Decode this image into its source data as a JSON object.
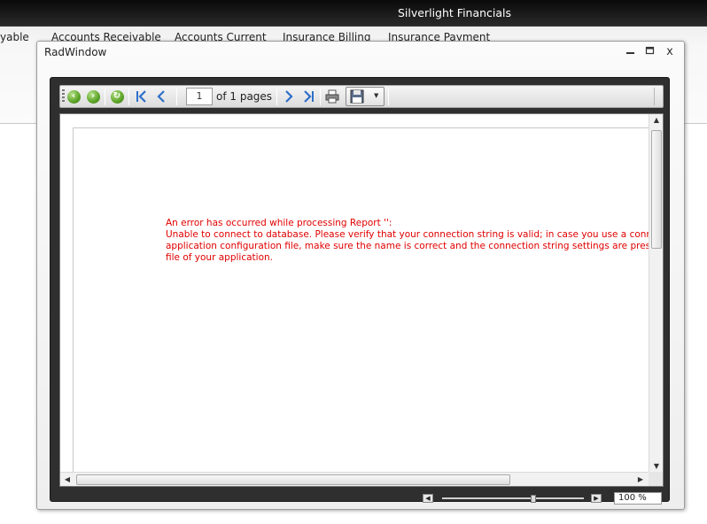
{
  "app": {
    "title": "Silverlight Financials",
    "tabs": [
      "yable",
      "Accounts Receivable",
      "Accounts Current",
      "Insurance Billing",
      "Insurance Payment"
    ]
  },
  "window": {
    "title": "RadWindow",
    "minimize_icon": "minimize-icon",
    "maximize_icon": "maximize-icon",
    "close_label": "x"
  },
  "toolbar": {
    "page_number": "1",
    "page_of": "of 1 pages",
    "icons": [
      "back-icon",
      "forward-icon",
      "refresh-icon",
      "first-page-icon",
      "previous-page-icon",
      "next-page-icon",
      "last-page-icon",
      "print-icon",
      "save-icon"
    ]
  },
  "report": {
    "error_lines": [
      "An error has occurred while processing Report '':",
      "Unable to connect to database. Please verify that your connection string is valid; in case you use a connection strir",
      "application configuration file, make sure the name is correct and the connection string settings are present in the c",
      "file of your application."
    ],
    "error_color": "#e00000"
  },
  "zoom": {
    "value": "100 %"
  }
}
